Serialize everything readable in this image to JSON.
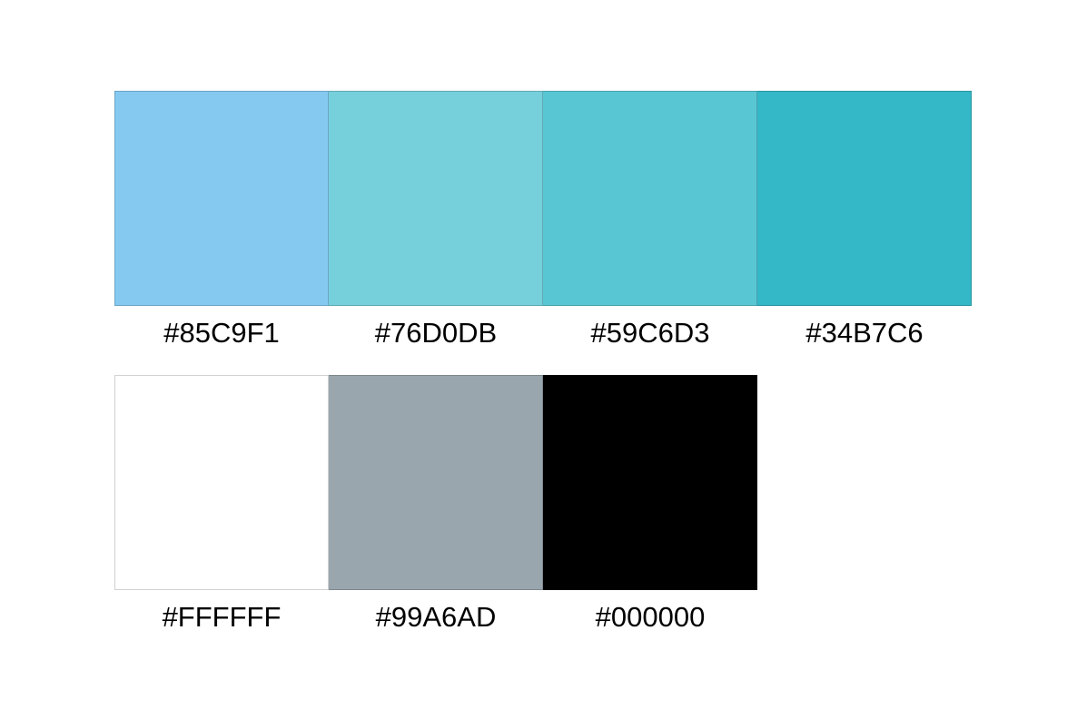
{
  "palette": {
    "primary": [
      {
        "hex": "#85C9F1",
        "color": "#85C9F1"
      },
      {
        "hex": "#76D0DB",
        "color": "#76D0DB"
      },
      {
        "hex": "#59C6D3",
        "color": "#59C6D3"
      },
      {
        "hex": "#34B7C6",
        "color": "#34B7C6"
      }
    ],
    "neutral": [
      {
        "hex": "#FFFFFF",
        "color": "#FFFFFF"
      },
      {
        "hex": "#99A6AD",
        "color": "#99A6AD"
      },
      {
        "hex": "#000000",
        "color": "#000000"
      }
    ]
  }
}
